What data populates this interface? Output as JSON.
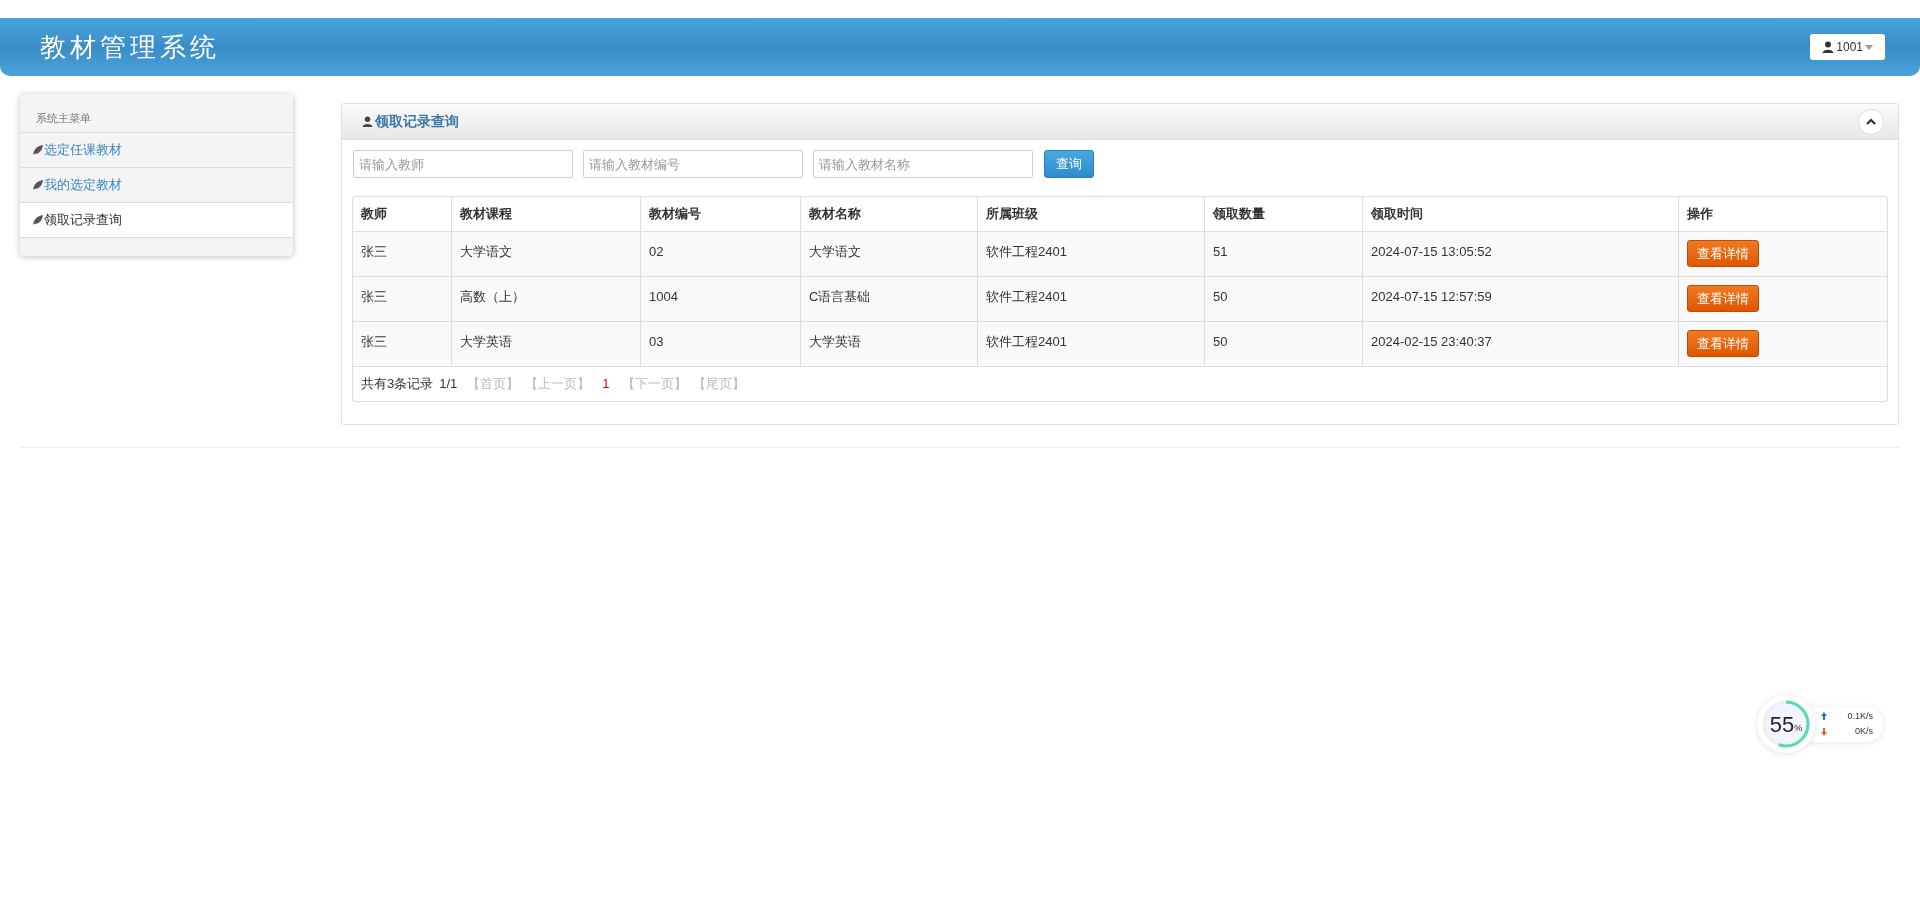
{
  "header": {
    "title": "教材管理系统",
    "user": "1001"
  },
  "sidebar": {
    "heading": "系统主菜单",
    "items": [
      {
        "label": "选定任课教材",
        "selected": false
      },
      {
        "label": "我的选定教材",
        "selected": false
      },
      {
        "label": "领取记录查询",
        "selected": true
      }
    ]
  },
  "panel": {
    "title": "领取记录查询",
    "search": {
      "fields": [
        {
          "placeholder": "请输入教师"
        },
        {
          "placeholder": "请输入教材编号"
        },
        {
          "placeholder": "请输入教材名称"
        }
      ],
      "button": "查询"
    },
    "table": {
      "columns": [
        "教师",
        "教材课程",
        "教材编号",
        "教材名称",
        "所属班级",
        "领取数量",
        "领取时间",
        "操作"
      ],
      "rows": [
        {
          "cells": [
            "张三",
            "大学语文",
            "02",
            "大学语文",
            "软件工程2401",
            "51",
            "2024-07-15 13:05:52"
          ],
          "action": "查看详情"
        },
        {
          "cells": [
            "张三",
            "高数（上）",
            "1004",
            "C语言基础",
            "软件工程2401",
            "50",
            "2024-07-15 12:57:59"
          ],
          "action": "查看详情"
        },
        {
          "cells": [
            "张三",
            "大学英语",
            "03",
            "大学英语",
            "软件工程2401",
            "50",
            "2024-02-15 23:40:37"
          ],
          "action": "查看详情"
        }
      ]
    },
    "pagination": {
      "summary": "共有3条记录",
      "pages": "1/1",
      "links": [
        {
          "label": "【首页】",
          "kind": "link"
        },
        {
          "label": "【上一页】",
          "kind": "link"
        },
        {
          "label": "1",
          "kind": "current"
        },
        {
          "label": "【下一页】",
          "kind": "link"
        },
        {
          "label": "【尾页】",
          "kind": "link"
        }
      ]
    }
  },
  "monitor": {
    "percent": "55",
    "unit": "%",
    "level": 0.55,
    "upload": "0.1K/s",
    "download": "0K/s"
  }
}
